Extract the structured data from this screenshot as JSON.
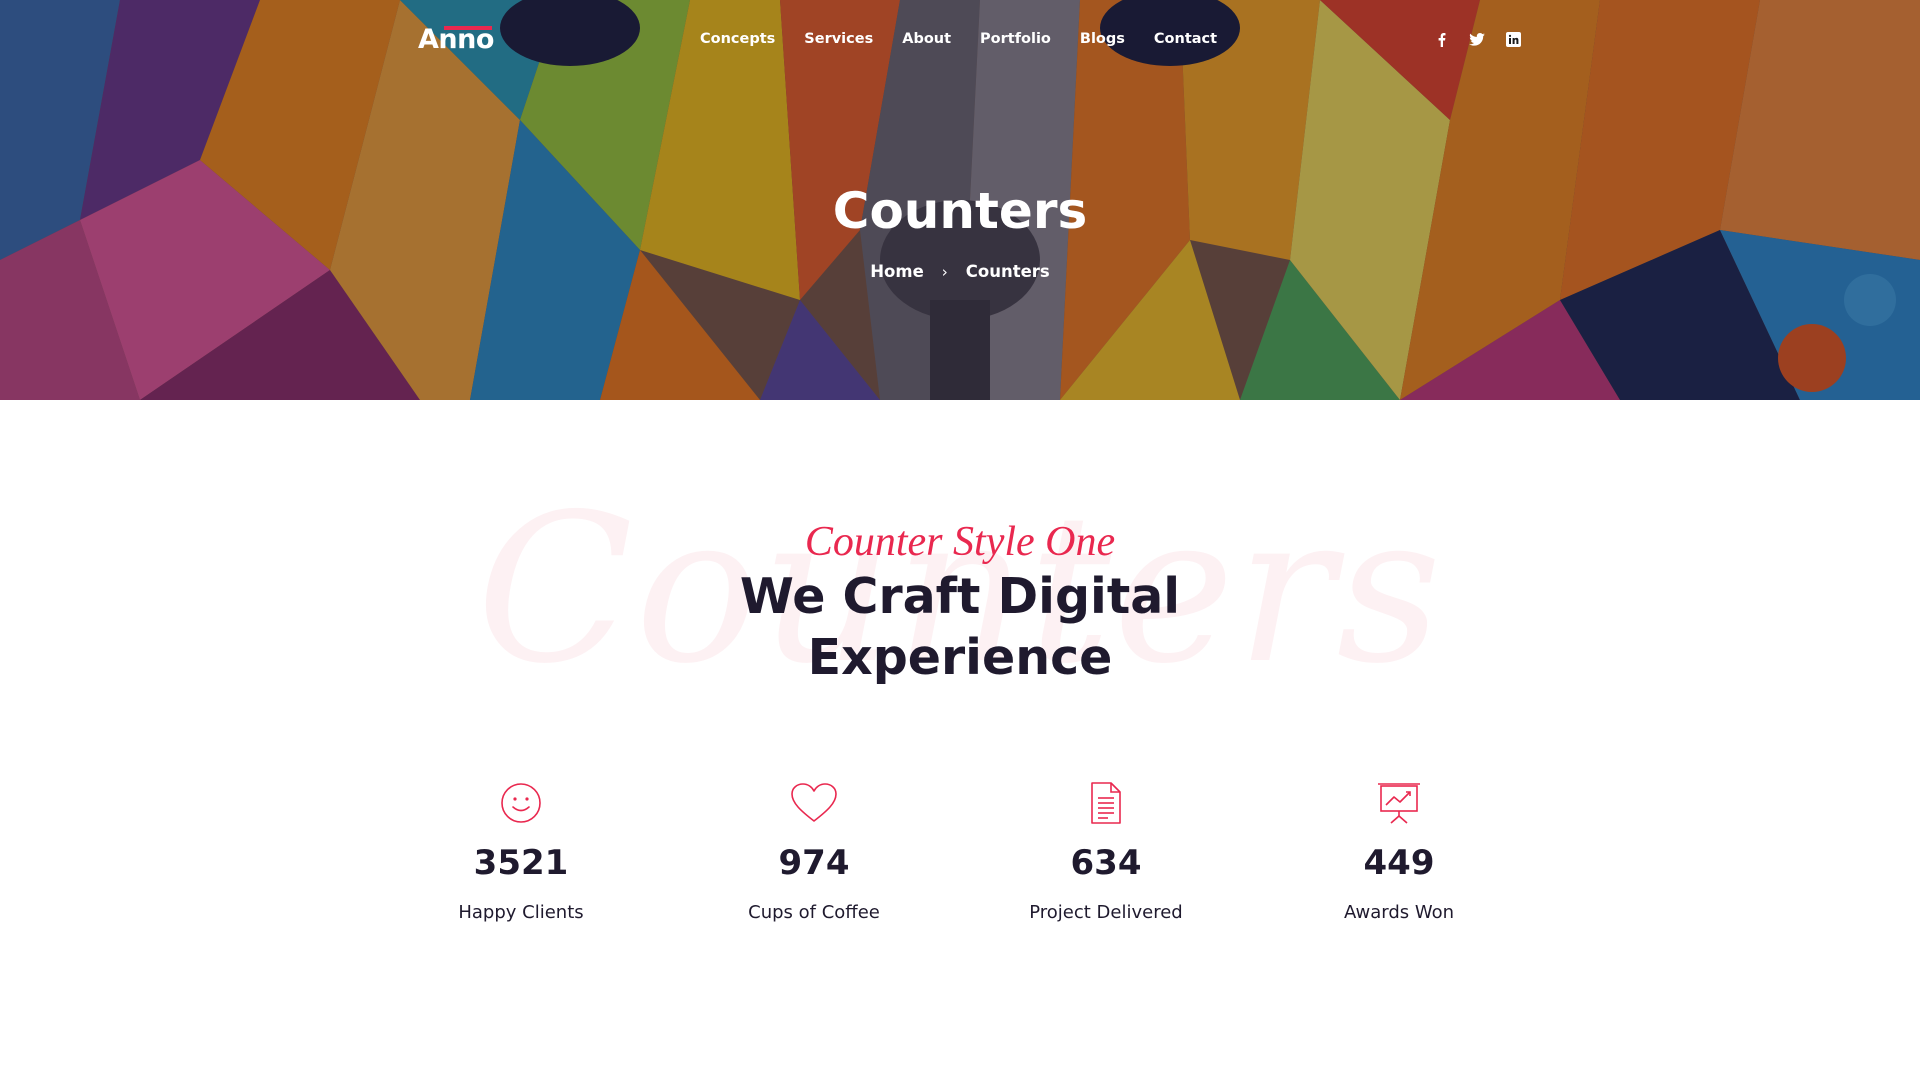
{
  "header": {
    "logo": "Anno",
    "nav": [
      "Concepts",
      "Services",
      "About",
      "Portfolio",
      "Blogs",
      "Contact"
    ],
    "social_icons": [
      "facebook-icon",
      "twitter-icon",
      "linkedin-icon"
    ]
  },
  "hero": {
    "title": "Counters",
    "breadcrumb": {
      "home": "Home",
      "separator": "›",
      "current": "Counters"
    }
  },
  "section": {
    "background_word": "Counters",
    "eyebrow": "Counter Style One",
    "headline_line1": "We Craft Digital",
    "headline_line2": "Experience"
  },
  "counters": [
    {
      "icon": "smiley-icon",
      "value": "3521",
      "label": "Happy Clients"
    },
    {
      "icon": "heart-icon",
      "value": "974",
      "label": "Cups of Coffee"
    },
    {
      "icon": "document-icon",
      "value": "634",
      "label": "Project Delivered"
    },
    {
      "icon": "presentation-icon",
      "value": "449",
      "label": "Awards Won"
    }
  ],
  "colors": {
    "accent": "#e9284f",
    "heading": "#1f1a2e",
    "background": "#ffffff"
  }
}
